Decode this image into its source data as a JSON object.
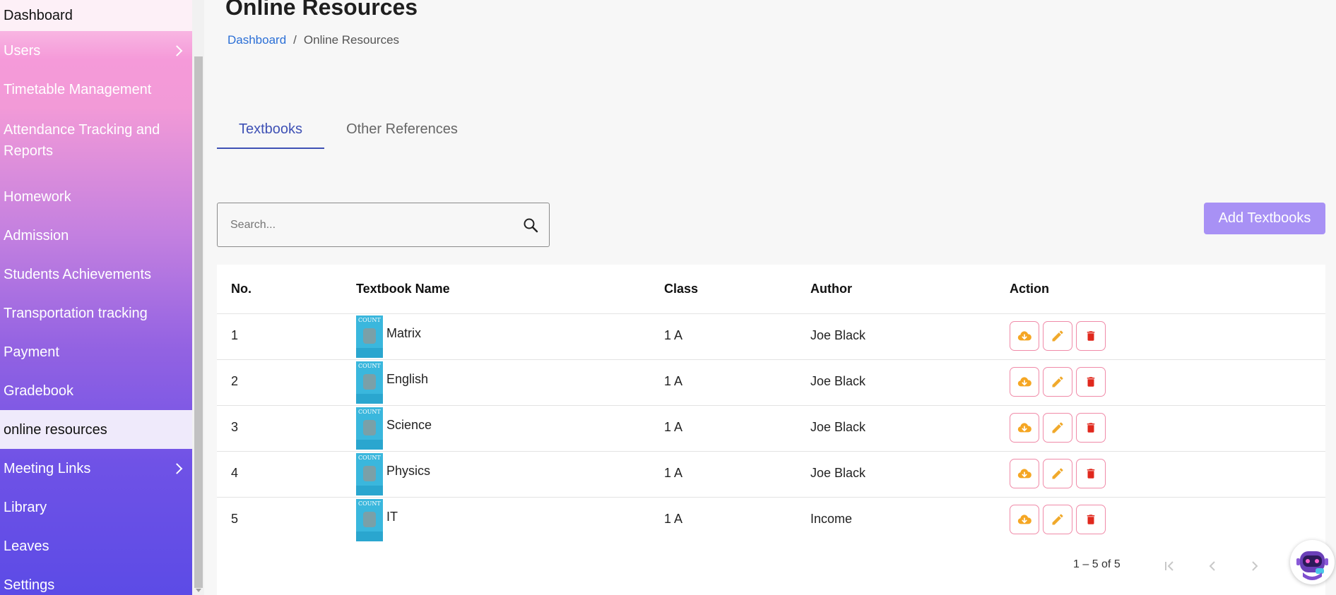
{
  "sidebar": {
    "items": [
      {
        "label": "Dashboard"
      },
      {
        "label": "Users"
      },
      {
        "label": "Timetable Management"
      },
      {
        "label": "Attendance Tracking and Reports"
      },
      {
        "label": "Homework"
      },
      {
        "label": "Admission"
      },
      {
        "label": "Students Achievements"
      },
      {
        "label": "Transportation tracking"
      },
      {
        "label": "Payment"
      },
      {
        "label": "Gradebook"
      },
      {
        "label": "online resources"
      },
      {
        "label": "Meeting Links"
      },
      {
        "label": "Library"
      },
      {
        "label": "Leaves"
      },
      {
        "label": "Settings"
      }
    ]
  },
  "header": {
    "title": "Online Resources",
    "breadcrumb": {
      "home": "Dashboard",
      "separator": "/",
      "current": "Online Resources"
    }
  },
  "tabs": [
    {
      "label": "Textbooks",
      "active": true
    },
    {
      "label": "Other References",
      "active": false
    }
  ],
  "search": {
    "placeholder": "Search...",
    "value": ""
  },
  "add_button": {
    "label": "Add Textbooks"
  },
  "table": {
    "columns": [
      "No.",
      "Textbook Name",
      "Class",
      "Author",
      "Action"
    ],
    "rows": [
      {
        "no": "1",
        "name": "Matrix",
        "class": "1 A",
        "author": "Joe Black"
      },
      {
        "no": "2",
        "name": "English",
        "class": "1 A",
        "author": "Joe Black"
      },
      {
        "no": "3",
        "name": "Science",
        "class": "1 A",
        "author": "Joe Black"
      },
      {
        "no": "4",
        "name": "Physics",
        "class": "1 A",
        "author": "Joe Black"
      },
      {
        "no": "5",
        "name": "IT",
        "class": "1 A",
        "author": "Income"
      }
    ],
    "thumb_text": "COUNT"
  },
  "pagination": {
    "range_text": "1 – 5 of 5"
  },
  "colors": {
    "accent": "#3f51b5",
    "add_button": "#a891f5",
    "download": "#f5a623",
    "edit": "#f0a92b",
    "delete": "#e0281d"
  },
  "icons": [
    "search-icon",
    "chevron-right-icon",
    "cloud-download-icon",
    "pencil-icon",
    "trash-icon",
    "first-page-icon",
    "previous-page-icon",
    "next-page-icon",
    "last-page-icon",
    "robot-assistant-icon"
  ]
}
